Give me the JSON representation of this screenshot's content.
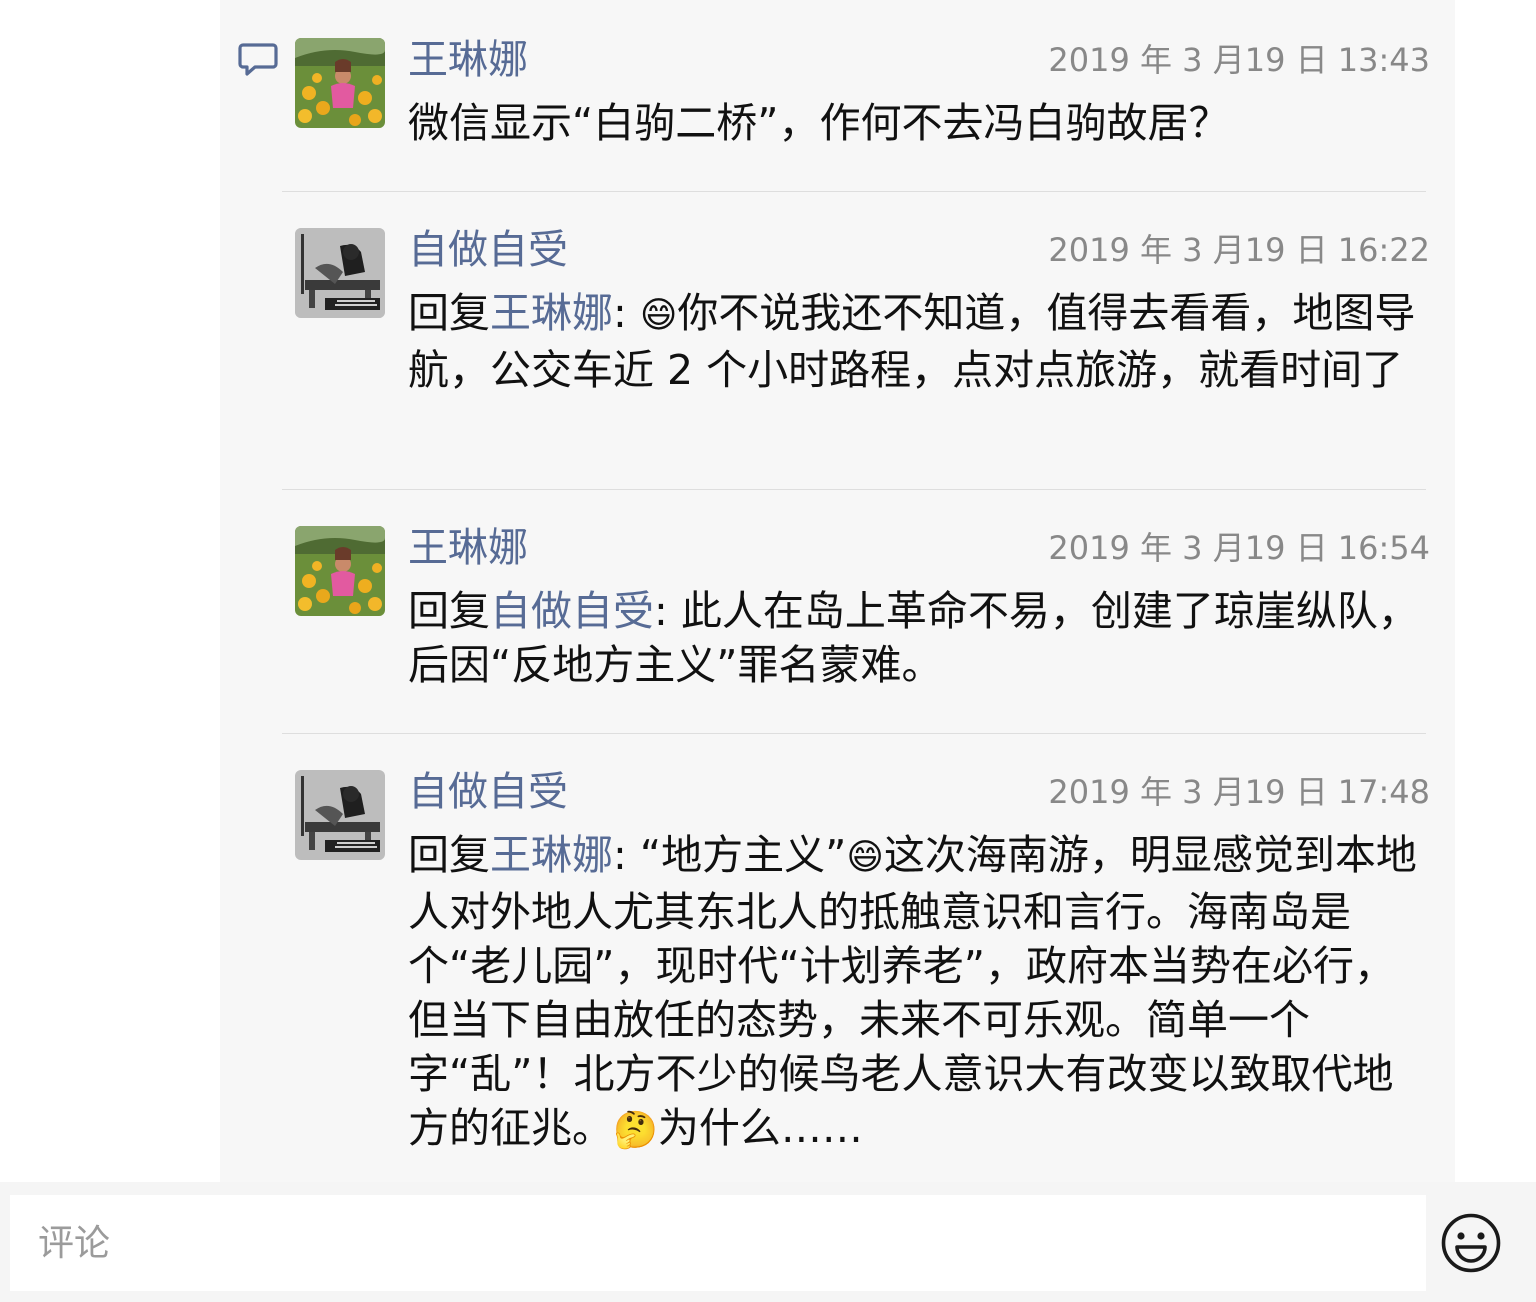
{
  "icons": {
    "comment": "speech-bubble-icon",
    "emoji_keyboard": "smiley-face-icon"
  },
  "colors": {
    "link": "#576b95",
    "timestamp": "#888888",
    "panel_bg": "#f7f7f7"
  },
  "comments": [
    {
      "author": "王琳娜",
      "time": "2019 年 3 月19 日 13:43",
      "text": "微信显示“白驹二桥”，作何不去冯白驹故居？"
    },
    {
      "author": "自做自受",
      "time": "2019 年 3 月19 日 16:22",
      "reply_prefix": "回复",
      "reply_to": "王琳娜",
      "reply_sep": ": ",
      "emoji": "😄",
      "text": "你不说我还不知道，值得去看看，地图导航，公交车近 2 个小时路程，点对点旅游，就看时间了"
    },
    {
      "author": "王琳娜",
      "time": "2019 年 3 月19 日 16:54",
      "reply_prefix": "回复",
      "reply_to": "自做自受",
      "reply_sep": ": ",
      "text": "此人在岛上革命不易，创建了琼崖纵队，后因“反地方主义”罪名蒙难。"
    },
    {
      "author": "自做自受",
      "time": "2019 年 3 月19 日 17:48",
      "reply_prefix": "回复",
      "reply_to": "王琳娜",
      "reply_sep": ": ",
      "text_a": "“地方主义”",
      "emoji_a": "😄",
      "text_b": "这次海南游，明显感觉到本地人对外地人尤其东北人的抵触意识和言行。海南岛是个“老儿园”，现时代“计划养老”，政府本当势在必行，但当下自由放任的态势，未来不可乐观。简单一个字“乱”！北方不少的候鸟老人意识大有改变以致取代地方的征兆。",
      "emoji_b": "🤔",
      "text_c": "为什么……"
    }
  ],
  "input": {
    "placeholder": "评论"
  }
}
